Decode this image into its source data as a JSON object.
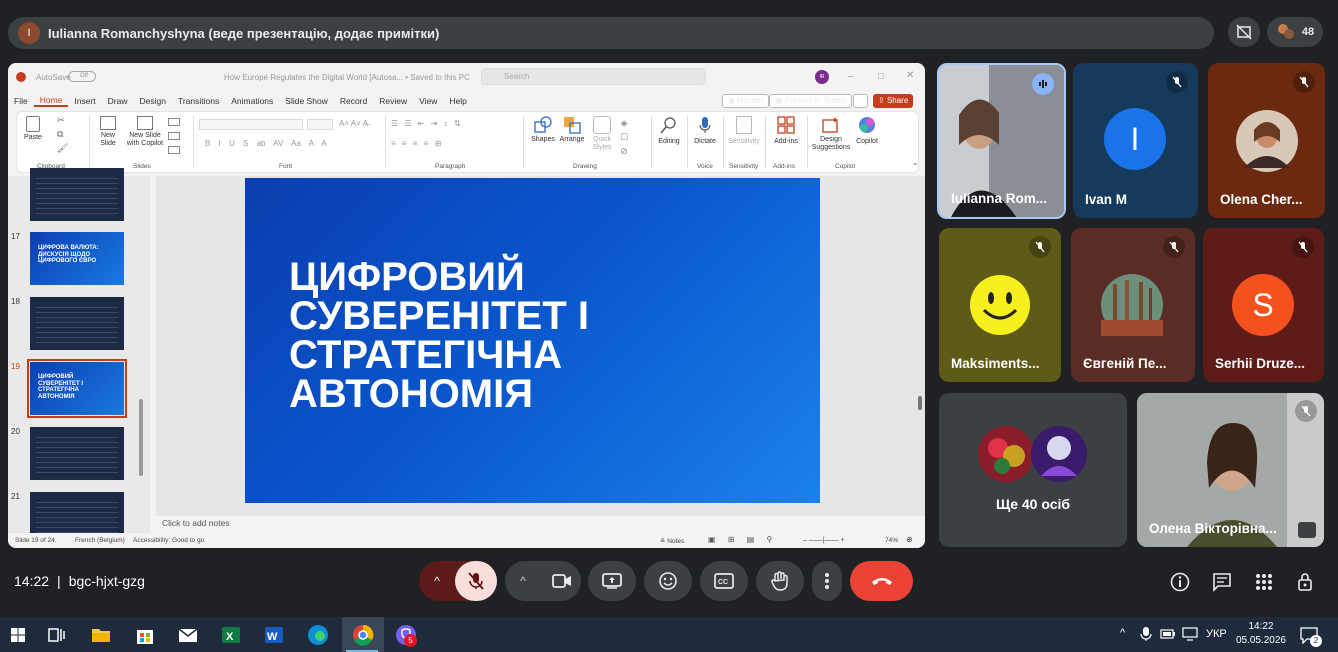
{
  "top": {
    "presenter_initial": "I",
    "presenter_text": "Iulianna Romanchyshyna (веде презентацію, додає примітки)",
    "participant_count": "48"
  },
  "ppt": {
    "autosave": "AutoSave",
    "autosave_state": "Off",
    "doc_title": "How Europe Regulates the Digital World [Autosa... • Saved to this PC",
    "search_placeholder": "Search",
    "user_initials": "IR",
    "menu": [
      "File",
      "Home",
      "Insert",
      "Draw",
      "Design",
      "Transitions",
      "Animations",
      "Slide Show",
      "Record",
      "Review",
      "View",
      "Help"
    ],
    "record_btn": "Record",
    "present_btn": "Present in Teams",
    "share_btn": "Share",
    "ribbon": {
      "paste": "Paste",
      "clipboard": "Clipboard",
      "new_slide": "New\nSlide",
      "new_slide_copilot": "New Slide\nwith Copilot",
      "slides": "Slides",
      "font": "Font",
      "paragraph": "Paragraph",
      "shapes": "Shapes",
      "arrange": "Arrange",
      "quick_styles": "Quick\nStyles",
      "drawing": "Drawing",
      "editing": "Editing",
      "dictate": "Dictate",
      "voice": "Voice",
      "sensitivity_btn": "Sensitivity",
      "sensitivity": "Sensitivity",
      "addins_btn": "Add-ins",
      "addins": "Add-ins",
      "design_suggestions": "Design\nSuggestions",
      "copilot_btn": "Copilot",
      "copilot": "Copilot"
    },
    "thumbs": [
      {
        "num": "17",
        "title": "ЦИФРОВА ВАЛЮТА:\nДИСКУСІЯ ЩОДО\nЦИФРОВОГО ЄВРО"
      },
      {
        "num": "18",
        "title": ""
      },
      {
        "num": "19",
        "title": "ЦИФРОВИЙ\nСУВЕРЕНІТЕТ І\nСТРАТЕГІЧНА\nАВТОНОМІЯ"
      },
      {
        "num": "20",
        "title": ""
      },
      {
        "num": "21",
        "title": ""
      }
    ],
    "slide_title": "ЦИФРОВИЙ\nСУВЕРЕНІТЕТ І\nСТРАТЕГІЧНА\nАВТОНОМІЯ",
    "notes_placeholder": "Click to add notes",
    "status": {
      "slide": "Slide 19 of 24",
      "language": "French (Belgium)",
      "accessibility": "Accessibility: Good to go",
      "notes": "Notes",
      "zoom": "74%"
    }
  },
  "participants": [
    {
      "name": "Iulianna Rom...",
      "speaking": true
    },
    {
      "name": "Ivan M",
      "initial": "I",
      "muted": true
    },
    {
      "name": "Olena Cher...",
      "muted": true
    },
    {
      "name": "Maksiments...",
      "muted": true
    },
    {
      "name": "Євгеній Пе...",
      "muted": true
    },
    {
      "name": "Serhii Druze...",
      "initial": "S",
      "muted": true
    },
    {
      "name": "Ще 40 осіб"
    },
    {
      "name": "Олена Вікторівна...",
      "muted": true
    }
  ],
  "meeting": {
    "time": "14:22",
    "separator": "|",
    "code": "bgc-hjxt-gzg"
  },
  "taskbar": {
    "lang": "УКР",
    "time": "14:22",
    "date": "05.05.2026",
    "notif_count": "2",
    "viber_badge": "5"
  },
  "colors": {
    "end_call": "#ea4335",
    "mic_off": "#f9dedc",
    "ppt_accent": "#c43e1c",
    "tile_ivan": "#163a5c",
    "tile_olena": "#6b2a10",
    "tile_maks": "#5e5a18",
    "tile_yevhen": "#5a2d24",
    "tile_serhii": "#5e1c18"
  }
}
